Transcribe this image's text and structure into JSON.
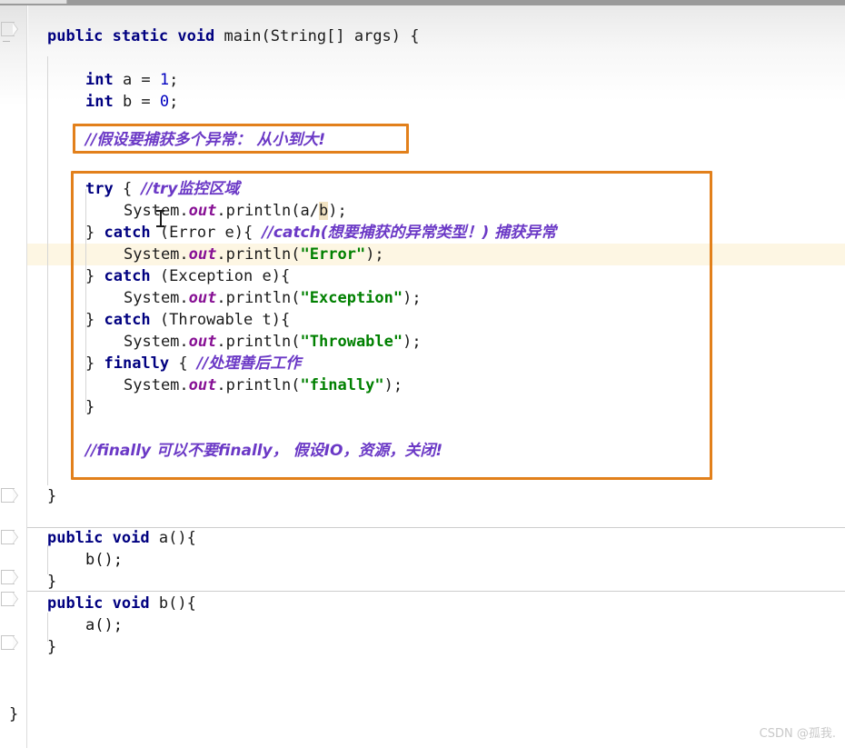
{
  "editor": {
    "font_size_px": 17,
    "line_height_px": 24,
    "background": "#ffffff",
    "caret_line_color": "#fdf6e3",
    "annotation_border_color": "#e2801b",
    "comment_color": "#6b39c6",
    "keyword_color": "#000080",
    "string_color": "#008000",
    "field_color": "#871094",
    "number_color": "#0000c0",
    "identifier_highlight_color": "#f2e3c2",
    "separator_color": "#cdcdcd"
  },
  "code": {
    "line_01": {
      "kw_public": "public",
      "kw_static": "static",
      "kw_void": "void",
      "name": "main",
      "sig": "(String[] args) {"
    },
    "line_03": {
      "kw": "int",
      "rest": " a = ",
      "num": "1",
      "end": ";"
    },
    "line_04": {
      "kw": "int",
      "rest": " b = ",
      "num": "0",
      "end": ";"
    },
    "line_06_comment": "//假设要捕获多个异常： 从小到大!",
    "line_08": {
      "kw": "try",
      "brace": " { ",
      "comment": "//try监控区域"
    },
    "line_09": {
      "obj": "System",
      "dot1": ".",
      "fld": "out",
      "dot2": ".",
      "call": "println(a/",
      "hl": "b",
      "end": ");"
    },
    "line_10": {
      "close": "} ",
      "kw": "catch",
      "sig": " (Error e){ ",
      "comment": "//catch(想要捕获的异常类型！) 捕获异常"
    },
    "line_11": {
      "obj": "System",
      "dot1": ".",
      "fld": "out",
      "dot2": ".",
      "call": "println(",
      "str": "\"Error\"",
      "end": ");"
    },
    "line_12": {
      "close": "} ",
      "kw": "catch",
      "sig": " (Exception e){"
    },
    "line_13": {
      "obj": "System",
      "dot1": ".",
      "fld": "out",
      "dot2": ".",
      "call": "println(",
      "str": "\"Exception\"",
      "end": ");"
    },
    "line_14": {
      "close": "} ",
      "kw": "catch",
      "sig": " (Throwable t){"
    },
    "line_15": {
      "obj": "System",
      "dot1": ".",
      "fld": "out",
      "dot2": ".",
      "call": "println(",
      "str": "\"Throwable\"",
      "end": ");"
    },
    "line_16": {
      "close": "} ",
      "kw": "finally",
      "sig": " { ",
      "comment": "//处理善后工作"
    },
    "line_17": {
      "obj": "System",
      "dot1": ".",
      "fld": "out",
      "dot2": ".",
      "call": "println(",
      "str": "\"finally\"",
      "end": ");"
    },
    "line_18": "}",
    "line_20_comment": "//finally 可以不要finally， 假设IO，资源，关闭!",
    "line_22": "}",
    "line_24": {
      "kw_public": "public",
      "kw_void": "void",
      "sig": " a(){"
    },
    "line_25": "b();",
    "line_26": "}",
    "line_27": {
      "kw_public": "public",
      "kw_void": "void",
      "sig": " b(){"
    },
    "line_28": "a();",
    "line_29": "}",
    "line_31": "}"
  },
  "annotations": {
    "box_comment_label": "comment-annotation-box",
    "box_try_label": "try-catch-annotation-box"
  },
  "watermark": {
    "text": "CSDN @孤我."
  }
}
